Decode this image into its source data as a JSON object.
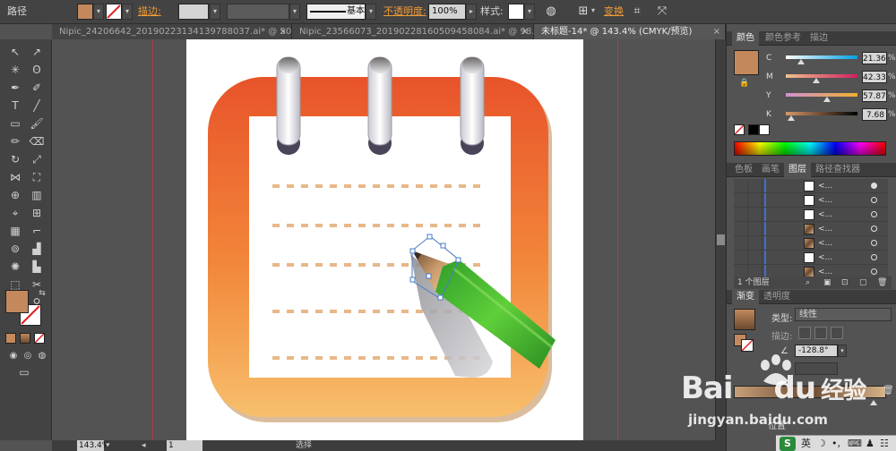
{
  "control_bar": {
    "path_label": "路径",
    "stroke_label": "描边:",
    "brush_label": "基本",
    "opacity_label": "不透明度:",
    "opacity_value": "100%",
    "style_label": "样式:",
    "transform_label": "变换",
    "fill_color": "#c3895c"
  },
  "tabs": [
    {
      "label": "Nipic_24206642_20190223134139788037.ai* @ 50...",
      "close": "×"
    },
    {
      "label": "Nipic_23566073_20190228160509458084.ai* @ 98...",
      "close": "×"
    },
    {
      "label": "未标题-14* @ 143.4% (CMYK/预览)",
      "close": "×"
    }
  ],
  "status": {
    "zoom": "143.4%",
    "page": "1",
    "mode": "选择"
  },
  "color_panel": {
    "tabs": [
      "颜色",
      "颜色参考",
      "描边"
    ],
    "channels": [
      {
        "ch": "C",
        "value": "21.36",
        "pct": "%",
        "pos": 0.21
      },
      {
        "ch": "M",
        "value": "42.33",
        "pct": "%",
        "pos": 0.42
      },
      {
        "ch": "Y",
        "value": "57.87",
        "pct": "%",
        "pos": 0.58
      },
      {
        "ch": "K",
        "value": "7.68",
        "pct": "%",
        "pos": 0.08
      }
    ],
    "swatch": "#c3895c"
  },
  "layers_panel": {
    "tabs": [
      "色板",
      "画笔",
      "图层",
      "路径查找器"
    ],
    "rows": [
      {
        "name": "<...",
        "thumb": "white",
        "target": "filled"
      },
      {
        "name": "<...",
        "thumb": "white",
        "target": "empty"
      },
      {
        "name": "<...",
        "thumb": "white",
        "target": "empty"
      },
      {
        "name": "<...",
        "thumb": "img",
        "target": "empty"
      },
      {
        "name": "<...",
        "thumb": "img",
        "target": "empty"
      },
      {
        "name": "<...",
        "thumb": "white",
        "target": "empty"
      },
      {
        "name": "<...",
        "thumb": "img",
        "target": "empty"
      }
    ],
    "footer": "1 个图层"
  },
  "gradient_panel": {
    "tabs": [
      "渐变",
      "透明度"
    ],
    "type_label": "类型:",
    "type_value": "线性",
    "stroke_label": "描边:",
    "angle_value": "-128.8°",
    "location_label": "位置"
  },
  "watermark": {
    "brand": "Bai",
    "brand2": "du",
    "cn": "经验",
    "url": "jingyan.baidu.com"
  },
  "tray": {
    "ime": "英"
  }
}
